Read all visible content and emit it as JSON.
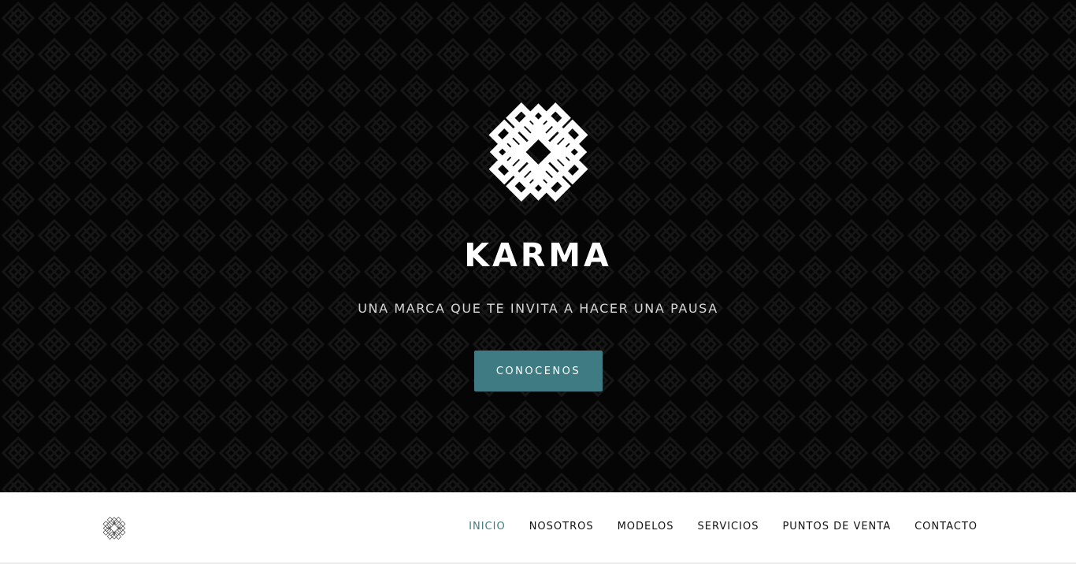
{
  "brand": {
    "name": "KARMA",
    "tagline": "UNA MARCA QUE TE INVITA A HACER UNA PAUSA",
    "cta_label": "CONOCENOS",
    "logo_icon": "endless-knot-icon"
  },
  "nav": {
    "logo_icon": "endless-knot-icon",
    "items": [
      {
        "label": "INICIO",
        "active": true
      },
      {
        "label": "NOSOTROS",
        "active": false
      },
      {
        "label": "MODELOS",
        "active": false
      },
      {
        "label": "SERVICIOS",
        "active": false
      },
      {
        "label": "PUNTOS DE VENTA",
        "active": false
      },
      {
        "label": "CONTACTO",
        "active": false
      }
    ]
  },
  "colors": {
    "hero_background": "#050505",
    "accent": "#3f7b82",
    "nav_text": "#111111",
    "nav_background": "#ffffff"
  }
}
